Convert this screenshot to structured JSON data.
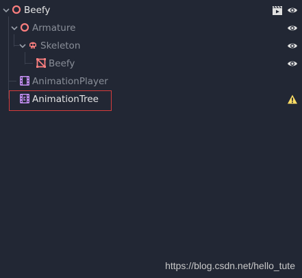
{
  "scene_tree": {
    "nodes": [
      {
        "label": "Beefy",
        "icon": "spatial-node-icon",
        "expanded": true,
        "visible": true,
        "extra_icon": "instance-scene-icon"
      },
      {
        "label": "Armature",
        "icon": "spatial-node-icon",
        "expanded": true,
        "visible": true
      },
      {
        "label": "Skeleton",
        "icon": "skeleton-icon",
        "expanded": true,
        "visible": true
      },
      {
        "label": "Beefy",
        "icon": "mesh-instance-icon",
        "visible": true
      },
      {
        "label": "AnimationPlayer",
        "icon": "animation-player-icon"
      },
      {
        "label": "AnimationTree",
        "icon": "animation-tree-icon",
        "warning": true,
        "selected_highlight": true
      }
    ]
  },
  "colors": {
    "background": "#222734",
    "node_pink": "#fc7f7f",
    "anim_purple": "#c38ef1",
    "warning": "#ffdd65",
    "highlight_box": "#d83c3c"
  },
  "watermark": "https://blog.csdn.net/hello_tute"
}
